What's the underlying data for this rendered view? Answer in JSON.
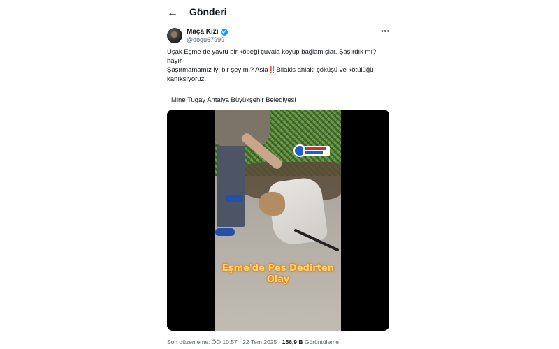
{
  "header": {
    "back_icon": "arrow-left-icon",
    "title": "Gönderi"
  },
  "tweet": {
    "author": {
      "name": "Maça Kızı",
      "handle": "@dogu67999",
      "verified": true
    },
    "more_icon": "more-horizontal-icon",
    "text_lines": [
      "Uşak Eşme de yavru bir köpeği çuvala koyup bağlamışlar. Şaşırdık mı?",
      "hayır",
      "Şaşırmamamız iyi bir şey mi? Asla",
      "Bilakis ahlaki çöküşü ve kötülüğü",
      "kanıksıyoruz."
    ],
    "emoji": "‼️",
    "caption": "Mine Tugay Antalya Büyükşehir Belediyesi",
    "media": {
      "overlay_text_1": "Eşme'de Pes Dedirten",
      "overlay_text_2": "Olay"
    },
    "meta": {
      "edited_prefix": "Son düzenleme: ÖÖ 10:57 · 22 Tem 2025 · ",
      "views": "156,9 B",
      "views_suffix": " Görüntüleme"
    }
  },
  "colors": {
    "accent": "#1d9bf0",
    "secondary_text": "#536471",
    "overlay_text": "#ffd36b"
  }
}
